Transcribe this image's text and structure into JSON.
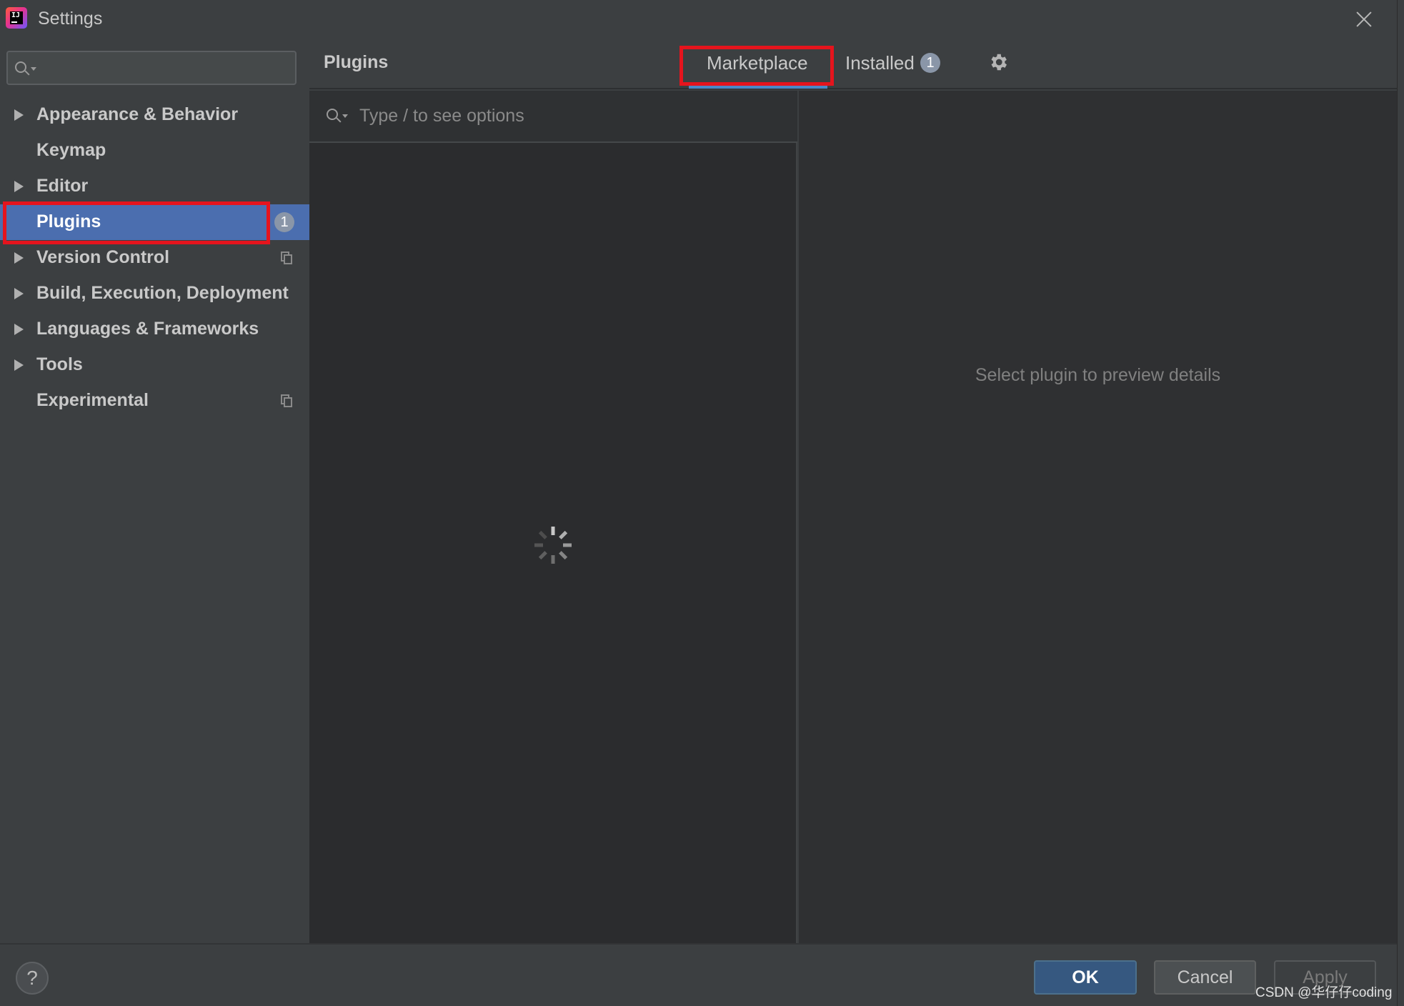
{
  "window": {
    "title": "Settings"
  },
  "sidebar": {
    "search": {
      "placeholder": "",
      "value": ""
    },
    "items": [
      {
        "label": "Appearance & Behavior",
        "expandable": true
      },
      {
        "label": "Keymap",
        "expandable": false
      },
      {
        "label": "Editor",
        "expandable": true
      },
      {
        "label": "Plugins",
        "expandable": false,
        "selected": true,
        "badge": "1"
      },
      {
        "label": "Version Control",
        "expandable": true,
        "icon": "project-settings-icon"
      },
      {
        "label": "Build, Execution, Deployment",
        "expandable": true
      },
      {
        "label": "Languages & Frameworks",
        "expandable": true
      },
      {
        "label": "Tools",
        "expandable": true
      },
      {
        "label": "Experimental",
        "expandable": false,
        "icon": "project-settings-icon"
      }
    ]
  },
  "main": {
    "title": "Plugins",
    "tabs": [
      {
        "label": "Marketplace",
        "active": true
      },
      {
        "label": "Installed",
        "badge": "1"
      }
    ],
    "settings_icon": "gear-icon",
    "search": {
      "placeholder": "Type / to see options",
      "value": ""
    },
    "loading_icon": "spinner-icon",
    "detail_empty_text": "Select plugin to preview details"
  },
  "footer": {
    "help_label": "?",
    "ok_label": "OK",
    "cancel_label": "Cancel",
    "apply_label": "Apply"
  },
  "watermark": "CSDN @华仔仔coding",
  "colors": {
    "background": "#3c3f41",
    "selection": "#4b6eaf",
    "highlight_box": "#e5141d",
    "tab_underline": "#4a88c7",
    "ok_button": "#365880"
  }
}
